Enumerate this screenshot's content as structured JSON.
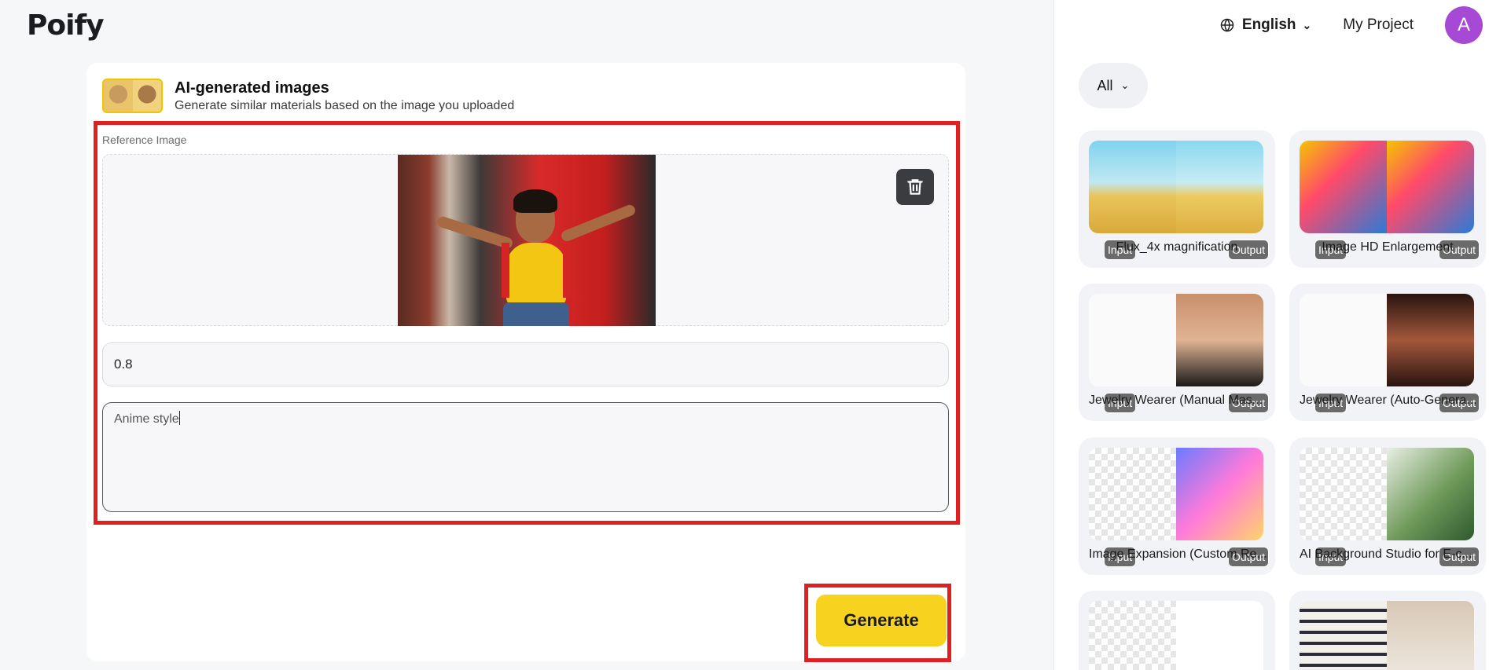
{
  "brand": {
    "logo_text": "Poify"
  },
  "card": {
    "title": "AI-generated images",
    "subtitle": "Generate similar materials based on the image you uploaded",
    "reference_label": "Reference Image",
    "strength_value": "0.8",
    "prompt_value": "Anime style",
    "generate_label": "Generate"
  },
  "topbar": {
    "language": "English",
    "my_project": "My Project",
    "avatar_letter": "A"
  },
  "filter": {
    "label": "All"
  },
  "badges": {
    "input": "Input",
    "output": "Output"
  },
  "tools": [
    {
      "name": "Flux_4x magnification"
    },
    {
      "name": "Image HD Enlargement"
    },
    {
      "name": "Jewelry Wearer (Manual Mas..."
    },
    {
      "name": "Jewelry Wearer (Auto-Genera..."
    },
    {
      "name": "Image Expansion (Custom Re..."
    },
    {
      "name": "AI Background Studio for E-c..."
    }
  ],
  "colors": {
    "accent_yellow": "#f7d21e",
    "highlight_red": "#e02020",
    "avatar_purple": "#a64ad6"
  }
}
